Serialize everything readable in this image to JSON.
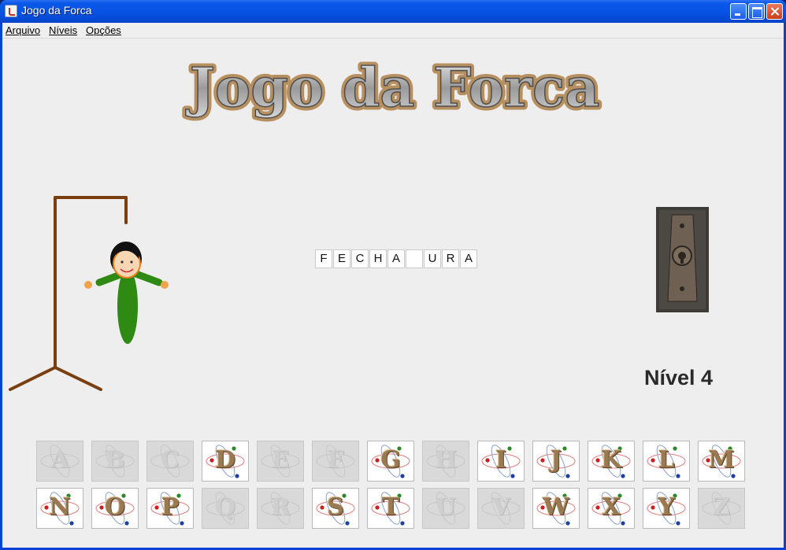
{
  "window": {
    "title": "Jogo da Forca"
  },
  "menu": [
    "Arquivo",
    "Níveis",
    "Opções"
  ],
  "logo_text": "Jogo da Forca",
  "word": [
    "F",
    "E",
    "C",
    "H",
    "A",
    "",
    "U",
    "R",
    "A"
  ],
  "level_label": "Nível 4",
  "keyboard": [
    {
      "letter": "A",
      "used": true
    },
    {
      "letter": "B",
      "used": true
    },
    {
      "letter": "C",
      "used": true
    },
    {
      "letter": "D",
      "used": false
    },
    {
      "letter": "E",
      "used": true
    },
    {
      "letter": "F",
      "used": true
    },
    {
      "letter": "G",
      "used": false
    },
    {
      "letter": "H",
      "used": true
    },
    {
      "letter": "I",
      "used": false
    },
    {
      "letter": "J",
      "used": false
    },
    {
      "letter": "K",
      "used": false
    },
    {
      "letter": "L",
      "used": false
    },
    {
      "letter": "M",
      "used": false
    },
    {
      "letter": "N",
      "used": false
    },
    {
      "letter": "O",
      "used": false
    },
    {
      "letter": "P",
      "used": false
    },
    {
      "letter": "Q",
      "used": true
    },
    {
      "letter": "R",
      "used": true
    },
    {
      "letter": "S",
      "used": false
    },
    {
      "letter": "T",
      "used": false
    },
    {
      "letter": "U",
      "used": true
    },
    {
      "letter": "V",
      "used": true
    },
    {
      "letter": "W",
      "used": false
    },
    {
      "letter": "X",
      "used": false
    },
    {
      "letter": "Y",
      "used": false
    },
    {
      "letter": "Z",
      "used": true
    }
  ],
  "colors": {
    "rope": "#7a3f10",
    "shirt": "#2f8a14",
    "skin": "#f2a24a",
    "hair": "#111111"
  }
}
